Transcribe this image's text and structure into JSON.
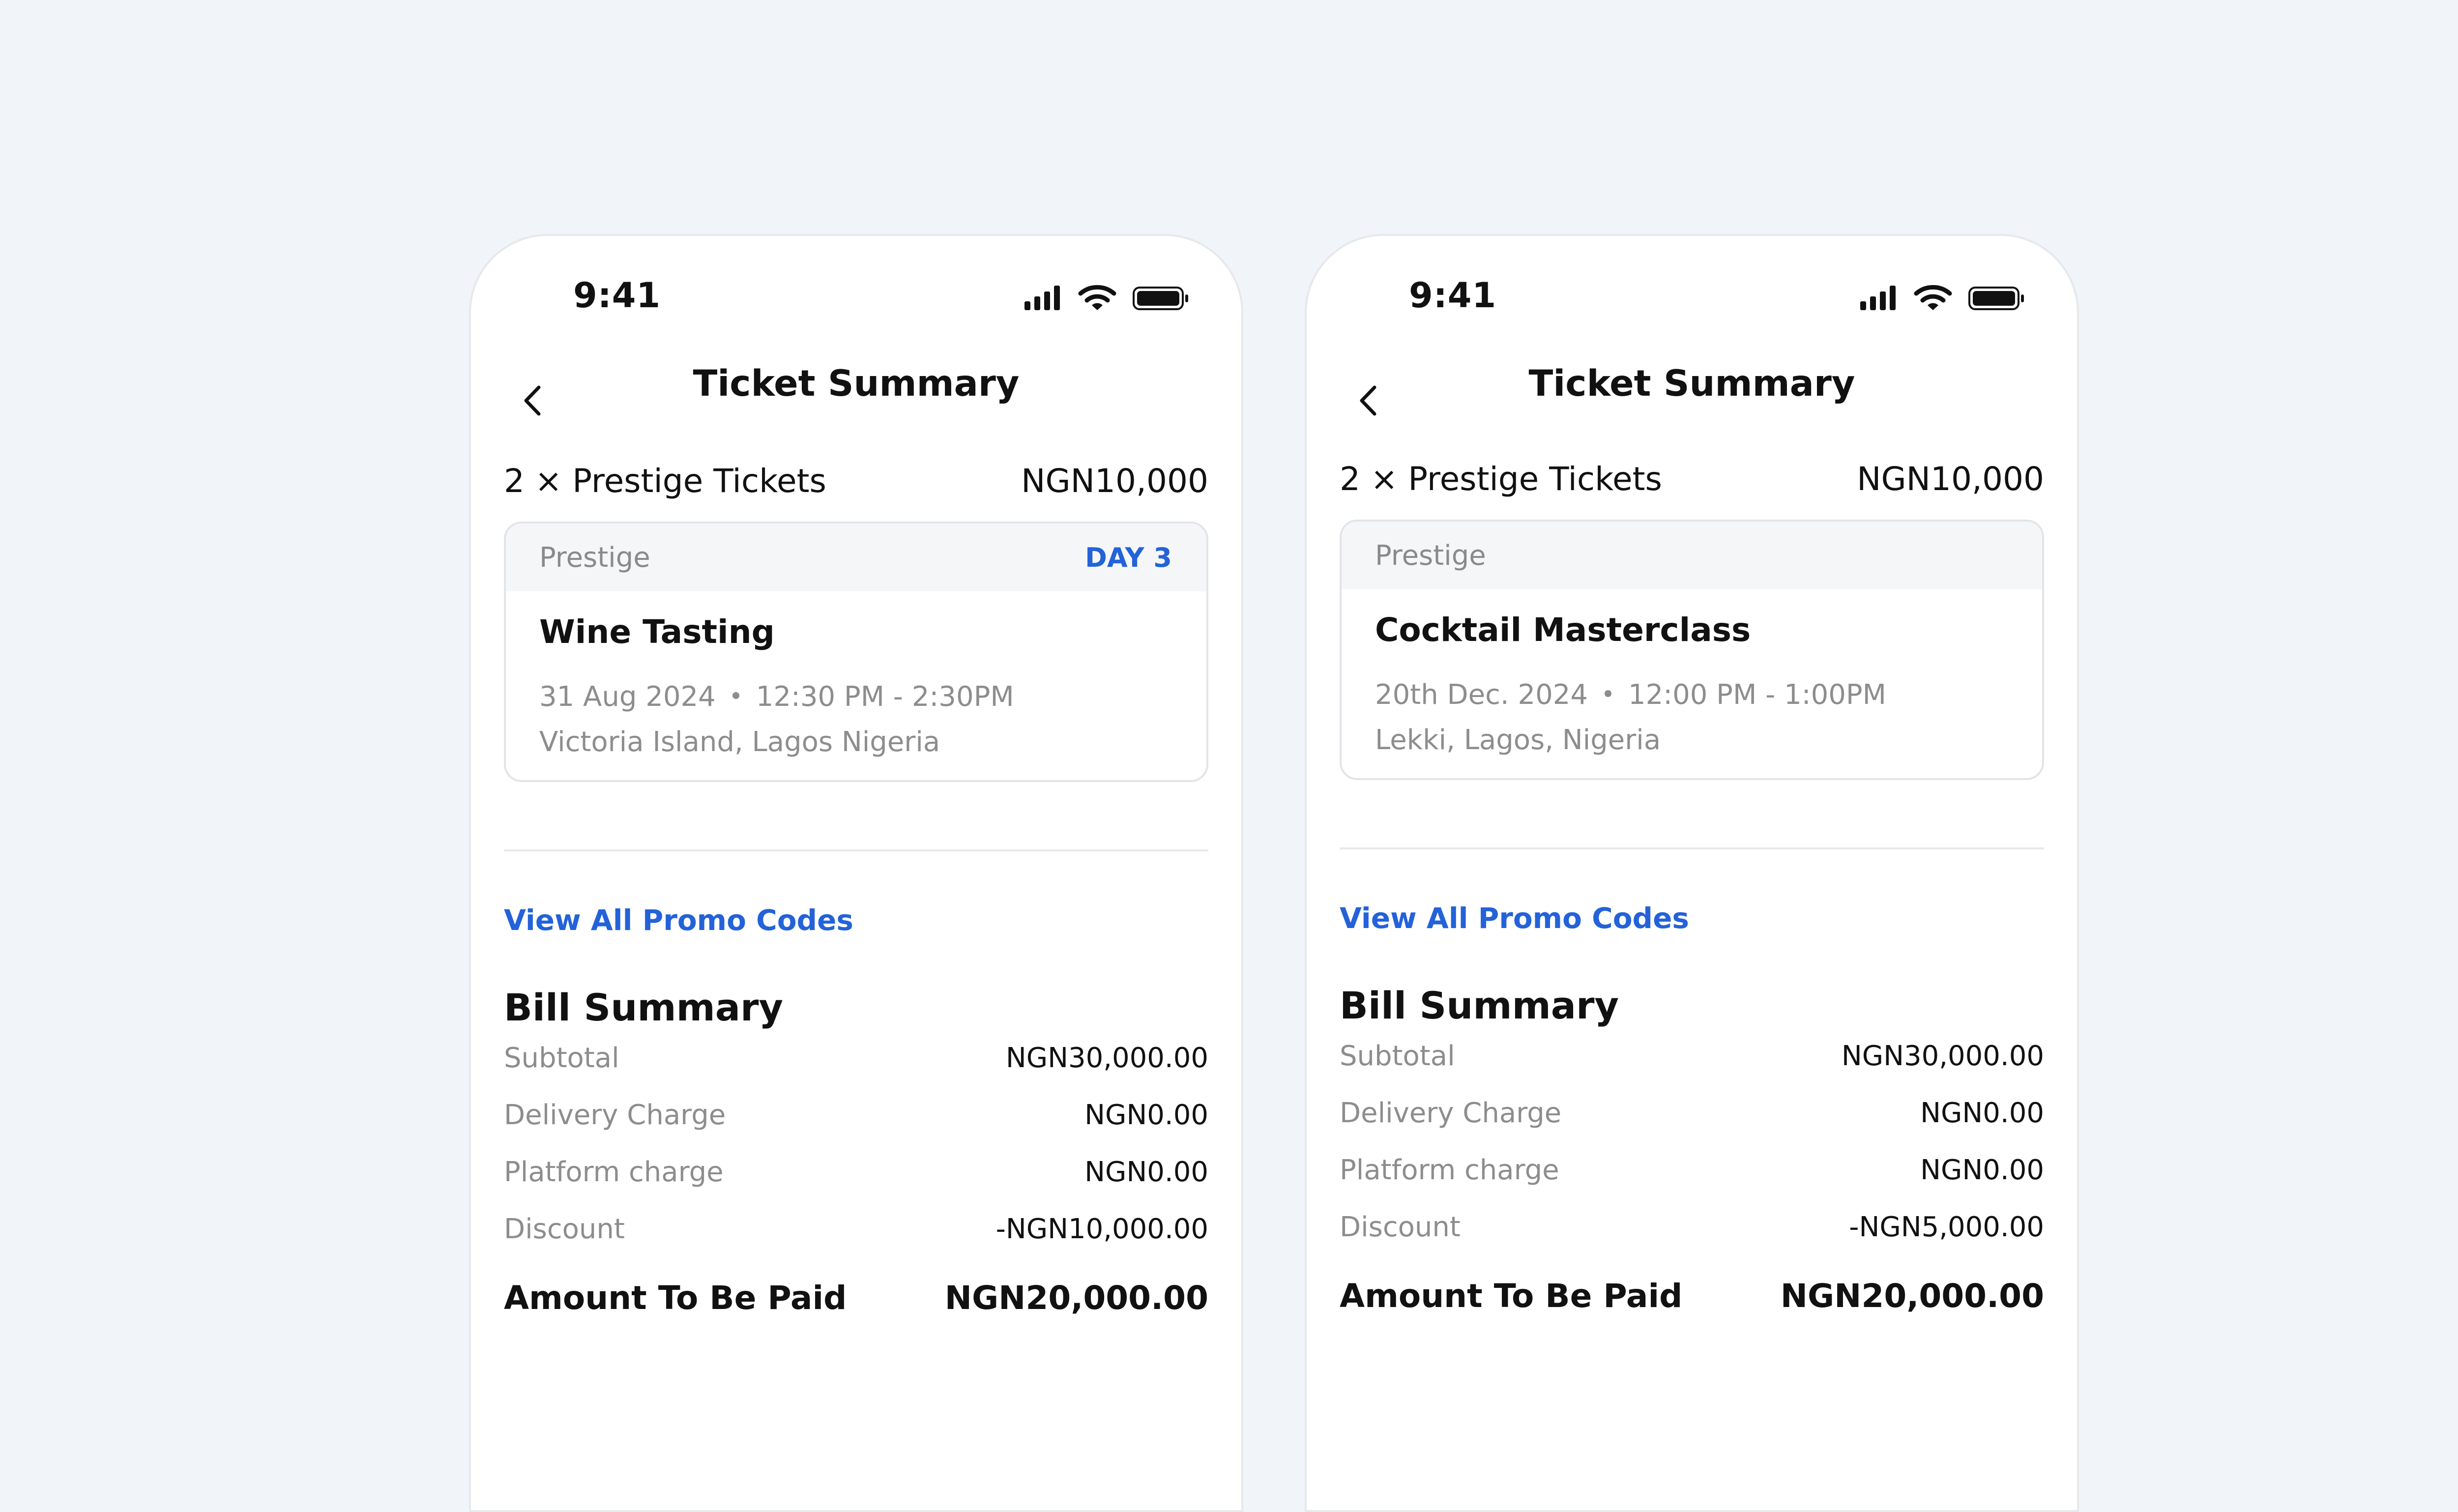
{
  "colors": {
    "background": "#f1f4f8",
    "accent": "#2362d9",
    "muted": "#8d8d8d"
  },
  "phones": [
    {
      "status_time": "9:41",
      "title": "Ticket Summary",
      "ticket_qty": "2 × Prestige Tickets",
      "ticket_price": "NGN10,000",
      "card": {
        "tier": "Prestige",
        "day": "DAY 3",
        "event": "Wine Tasting",
        "date": "31 Aug 2024",
        "time": "12:30 PM - 2:30PM",
        "location": "Victoria Island, Lagos Nigeria"
      },
      "promo_link": "View All Promo Codes",
      "bill_title": "Bill Summary",
      "bill_rows": [
        {
          "label": "Subtotal",
          "value": "NGN30,000.00"
        },
        {
          "label": "Delivery Charge",
          "value": "NGN0.00"
        },
        {
          "label": "Platform charge",
          "value": "NGN0.00"
        },
        {
          "label": "Discount",
          "value": "-NGN10,000.00"
        }
      ],
      "total_label": "Amount To Be Paid",
      "total_value": "NGN20,000.00"
    },
    {
      "status_time": "9:41",
      "title": "Ticket Summary",
      "ticket_qty": "2 × Prestige Tickets",
      "ticket_price": "NGN10,000",
      "card": {
        "tier": "Prestige",
        "day": "",
        "event": "Cocktail Masterclass",
        "date": "20th Dec. 2024",
        "time": "12:00 PM - 1:00PM",
        "location": "Lekki, Lagos, Nigeria"
      },
      "promo_link": "View All Promo Codes",
      "bill_title": "Bill Summary",
      "bill_rows": [
        {
          "label": "Subtotal",
          "value": "NGN30,000.00"
        },
        {
          "label": "Delivery Charge",
          "value": "NGN0.00"
        },
        {
          "label": "Platform charge",
          "value": "NGN0.00"
        },
        {
          "label": "Discount",
          "value": "-NGN5,000.00"
        }
      ],
      "total_label": "Amount To Be Paid",
      "total_value": "NGN20,000.00"
    }
  ]
}
